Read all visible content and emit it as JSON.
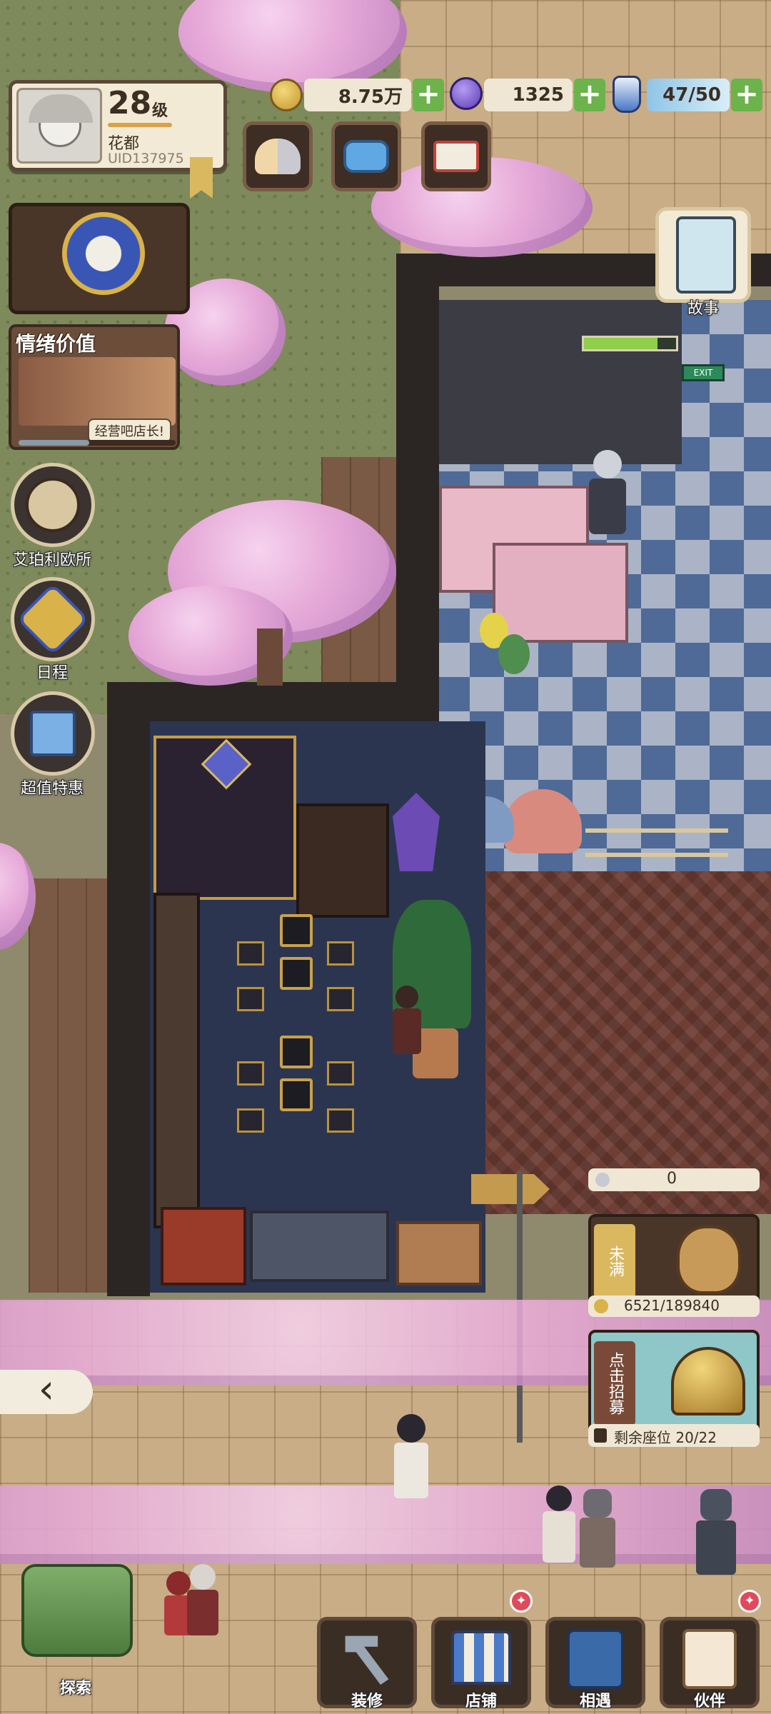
{
  "player": {
    "level": "28",
    "level_unit": "级",
    "name": "花都",
    "uid": "UID137975"
  },
  "resources": {
    "coins": "8.75万",
    "gems": "1325",
    "energy": "47/50",
    "plus": "+"
  },
  "side_menu": {
    "emotion_title": "情绪价值",
    "emotion_caption": "经营吧店长!",
    "office_label": "艾珀利欧所",
    "schedule_label": "日程",
    "deals_label": "超值特惠"
  },
  "story": {
    "label": "故事"
  },
  "shop_panel": {
    "counter": "0",
    "not_full": "未满",
    "progress": "6521/189840",
    "recruit": "点击招募",
    "seats": "剩余座位 20/22"
  },
  "back_arrow": "‹",
  "bottom_nav": {
    "explore": "探索",
    "decorate": "装修",
    "shop": "店铺",
    "meet": "相遇",
    "partner": "伙伴",
    "badge": "✦"
  },
  "exit_sign": "EXIT",
  "colors": {
    "accent_green": "#6bb34a",
    "panel_bg": "#f3ead6",
    "panel_border": "#5b4736",
    "blossom": "#e6a9d8"
  }
}
